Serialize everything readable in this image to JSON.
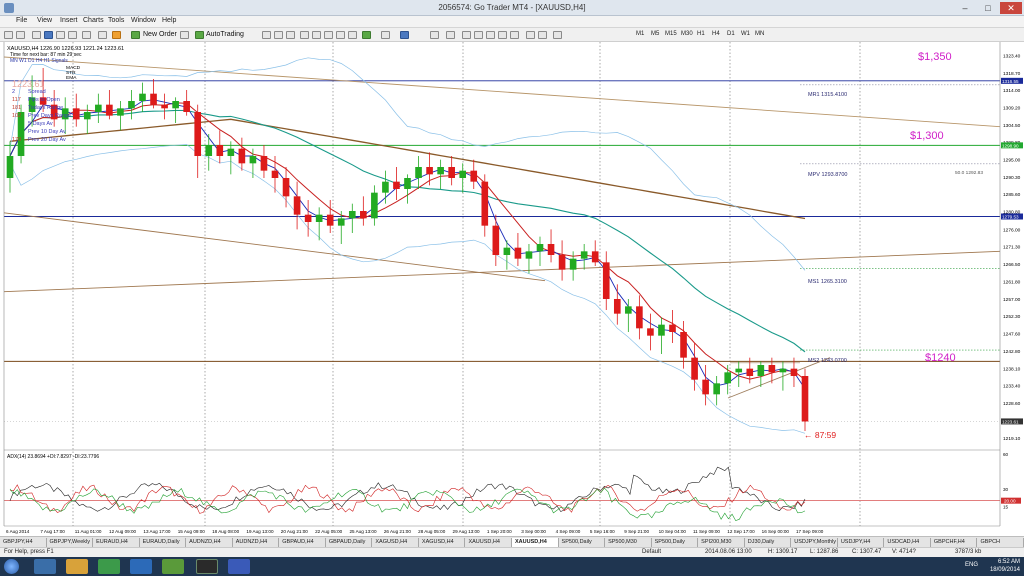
{
  "window": {
    "title": "2056574: Go Trader MT4 - [XAUUSD,H4]",
    "minimize": "–",
    "maximize": "□",
    "close": "✕"
  },
  "menu": [
    "File",
    "View",
    "Insert",
    "Charts",
    "Tools",
    "Window",
    "Help"
  ],
  "toolbar": {
    "new_order": "New Order",
    "autotrading": "AutoTrading",
    "timeframes": [
      "M1",
      "M5",
      "M15",
      "M30",
      "H1",
      "H4",
      "D1",
      "W1",
      "MN"
    ]
  },
  "chart_data": {
    "type": "candlestick",
    "title": "XAUUSD,H4  1226.90 1226.93 1221.24 1223.61",
    "info_lines": [
      "Time for next bar: 87 min 29 sec",
      "MN W1 D1 H4 H1 Signals"
    ],
    "indicator_labels": [
      "MACD",
      "STR",
      "EMA"
    ],
    "panel_rows": [
      [
        "1223.61",
        ""
      ],
      [
        "2",
        "Spread"
      ],
      [
        "117",
        "Pips to Open"
      ],
      [
        "181",
        "Todays Range"
      ],
      [
        "102",
        "Prev Days Range"
      ],
      [
        "",
        "5 Days Av"
      ],
      [
        "",
        "Prev 10 Day Av"
      ],
      [
        "170",
        "Prev 20 Day Av"
      ]
    ],
    "ylim": [
      1218,
      1326
    ],
    "y_ticks": [
      "1323.40",
      "1318.70",
      "1314.00",
      "1309.20",
      "1304.50",
      "1299.80",
      "1295.00",
      "1290.30",
      "1285.60",
      "1280.80",
      "1276.00",
      "1271.30",
      "1266.50",
      "1261.80",
      "1257.00",
      "1252.30",
      "1247.60",
      "1242.80",
      "1238.10",
      "1233.40",
      "1228.60",
      "1219.10"
    ],
    "x_labels": [
      "6 Aug 2014",
      "7 Aug 17:00",
      "11 Aug 01:00",
      "12 Aug 09:00",
      "13 Aug 17:00",
      "15 Aug 09:00",
      "18 Aug 08:00",
      "19 Aug 13:00",
      "20 Aug 21:00",
      "22 Aug 05:00",
      "25 Aug 13:00",
      "26 Aug 21:00",
      "28 Aug 05:00",
      "29 Aug 13:00",
      "1 Sep 20:00",
      "3 Sep 00:00",
      "4 Sep 09:00",
      "5 Sep 16:00",
      "9 Sep 21:00",
      "10 Sep 04:00",
      "11 Sep 09:00",
      "12 Sep 17:00",
      "16 Sep 00:00",
      "17 Sep 09:00"
    ],
    "pivots": [
      {
        "name": "MR1",
        "value": 1315.41,
        "label": "MR1  1315.4100"
      },
      {
        "name": "MPV",
        "value": 1293.87,
        "label": "MPV  1293.8700"
      },
      {
        "name": "MS1",
        "value": 1265.31,
        "label": "MS1  1265.3100"
      },
      {
        "name": "MS2",
        "value": 1243.07,
        "label": "MS2  1243.0700"
      }
    ],
    "mid_label": "50.0  1292.83",
    "annotations": [
      "$1,350",
      "$1,300",
      "$1240"
    ],
    "levels": {
      "blue_top": {
        "value": 1316.5,
        "label": "1316.55"
      },
      "green": {
        "value": 1298.9,
        "label": "1298.90"
      },
      "blue_mid": {
        "value": 1279.5,
        "label": "1279.53"
      },
      "brown": {
        "value": 1240,
        "label": ""
      },
      "current": {
        "value": 1223.61,
        "label": "1223.61"
      }
    },
    "countdown": "← 87:59",
    "candles": [
      [
        1290,
        1300,
        1286,
        1296
      ],
      [
        1296,
        1310,
        1294,
        1308
      ],
      [
        1308,
        1318,
        1304,
        1312
      ],
      [
        1312,
        1320,
        1308,
        1310
      ],
      [
        1310,
        1314,
        1304,
        1306
      ],
      [
        1306,
        1312,
        1302,
        1309
      ],
      [
        1309,
        1313,
        1304,
        1306
      ],
      [
        1306,
        1310,
        1302,
        1308
      ],
      [
        1308,
        1313,
        1305,
        1310
      ],
      [
        1310,
        1314,
        1306,
        1307
      ],
      [
        1307,
        1311,
        1303,
        1309
      ],
      [
        1309,
        1314,
        1306,
        1311
      ],
      [
        1311,
        1316,
        1308,
        1313
      ],
      [
        1313,
        1317,
        1309,
        1310
      ],
      [
        1310,
        1313,
        1306,
        1309
      ],
      [
        1309,
        1312,
        1305,
        1311
      ],
      [
        1311,
        1314,
        1307,
        1308
      ],
      [
        1308,
        1310,
        1290,
        1296
      ],
      [
        1296,
        1302,
        1292,
        1299
      ],
      [
        1299,
        1303,
        1294,
        1296
      ],
      [
        1296,
        1300,
        1291,
        1298
      ],
      [
        1298,
        1301,
        1292,
        1294
      ],
      [
        1294,
        1298,
        1290,
        1296
      ],
      [
        1296,
        1299,
        1290,
        1292
      ],
      [
        1292,
        1296,
        1286,
        1290
      ],
      [
        1290,
        1293,
        1282,
        1285
      ],
      [
        1285,
        1289,
        1276,
        1280
      ],
      [
        1280,
        1284,
        1274,
        1278
      ],
      [
        1278,
        1282,
        1273,
        1280
      ],
      [
        1280,
        1284,
        1275,
        1277
      ],
      [
        1277,
        1281,
        1272,
        1279
      ],
      [
        1279,
        1283,
        1275,
        1281
      ],
      [
        1281,
        1285,
        1277,
        1279
      ],
      [
        1279,
        1288,
        1277,
        1286
      ],
      [
        1286,
        1292,
        1283,
        1289
      ],
      [
        1289,
        1293,
        1284,
        1287
      ],
      [
        1287,
        1291,
        1283,
        1290
      ],
      [
        1290,
        1296,
        1287,
        1293
      ],
      [
        1293,
        1297,
        1288,
        1291
      ],
      [
        1291,
        1295,
        1287,
        1293
      ],
      [
        1293,
        1296,
        1288,
        1290
      ],
      [
        1290,
        1294,
        1286,
        1292
      ],
      [
        1292,
        1295,
        1287,
        1289
      ],
      [
        1289,
        1291,
        1274,
        1277
      ],
      [
        1277,
        1280,
        1266,
        1269
      ],
      [
        1269,
        1273,
        1265,
        1271
      ],
      [
        1271,
        1275,
        1266,
        1268
      ],
      [
        1268,
        1272,
        1264,
        1270
      ],
      [
        1270,
        1274,
        1266,
        1272
      ],
      [
        1272,
        1276,
        1267,
        1269
      ],
      [
        1269,
        1273,
        1262,
        1265
      ],
      [
        1265,
        1270,
        1262,
        1268
      ],
      [
        1268,
        1272,
        1265,
        1270
      ],
      [
        1270,
        1273,
        1266,
        1267
      ],
      [
        1267,
        1270,
        1254,
        1257
      ],
      [
        1257,
        1261,
        1250,
        1253
      ],
      [
        1253,
        1257,
        1248,
        1255
      ],
      [
        1255,
        1258,
        1246,
        1249
      ],
      [
        1249,
        1253,
        1243,
        1247
      ],
      [
        1247,
        1252,
        1242,
        1250
      ],
      [
        1250,
        1254,
        1245,
        1248
      ],
      [
        1248,
        1251,
        1238,
        1241
      ],
      [
        1241,
        1245,
        1232,
        1235
      ],
      [
        1235,
        1239,
        1228,
        1231
      ],
      [
        1231,
        1236,
        1228,
        1234
      ],
      [
        1234,
        1239,
        1231,
        1237
      ],
      [
        1237,
        1240,
        1233,
        1238
      ],
      [
        1238,
        1241,
        1234,
        1236
      ],
      [
        1236,
        1240,
        1233,
        1239
      ],
      [
        1239,
        1241,
        1234,
        1237
      ],
      [
        1237,
        1240,
        1232,
        1238
      ],
      [
        1238,
        1241,
        1233,
        1236
      ],
      [
        1236,
        1238,
        1221,
        1223.6
      ]
    ],
    "sub_indicator": {
      "label": "ADX(14) 23.8694 +DI:7.8297 -DI:23.7796",
      "ylim": [
        0,
        60
      ],
      "y_ticks": [
        "60",
        "30",
        "20",
        "15"
      ],
      "threshold": 20
    }
  },
  "tabs": [
    "GBPJPY,H4",
    "GBPJPY,Weekly",
    "EURAUD,H4",
    "EURAUD,Daily",
    "AUDNZD,H4",
    "AUDNZD,H4",
    "GBPAUD,H4",
    "GBPAUD,Daily",
    "XAGUSD,H4",
    "XAGUSD,H4",
    "XAUUSD,H4",
    "XAUUSD,H4",
    "SP500,Daily",
    "SP500,M30",
    "SP500,Daily",
    "SPI200,M30",
    "DJ30,Daily",
    "USDJPY,Monthly",
    "USDJPY,H4",
    "USDCAD,H4",
    "GBPCHF,H4",
    "GBPCH"
  ],
  "active_tab": 11,
  "status": {
    "help": "For Help, press F1",
    "profile": "Default",
    "datetime": "2014.08.06 13:00",
    "high": "H: 1309.17",
    "low": "L: 1287.86",
    "close": "C: 1307.47",
    "volume": "V: 4714?",
    "traffic": "3787/3 kb"
  },
  "taskbar": {
    "lang": "ENG",
    "time": "6:52 AM",
    "date": "18/09/2014"
  }
}
